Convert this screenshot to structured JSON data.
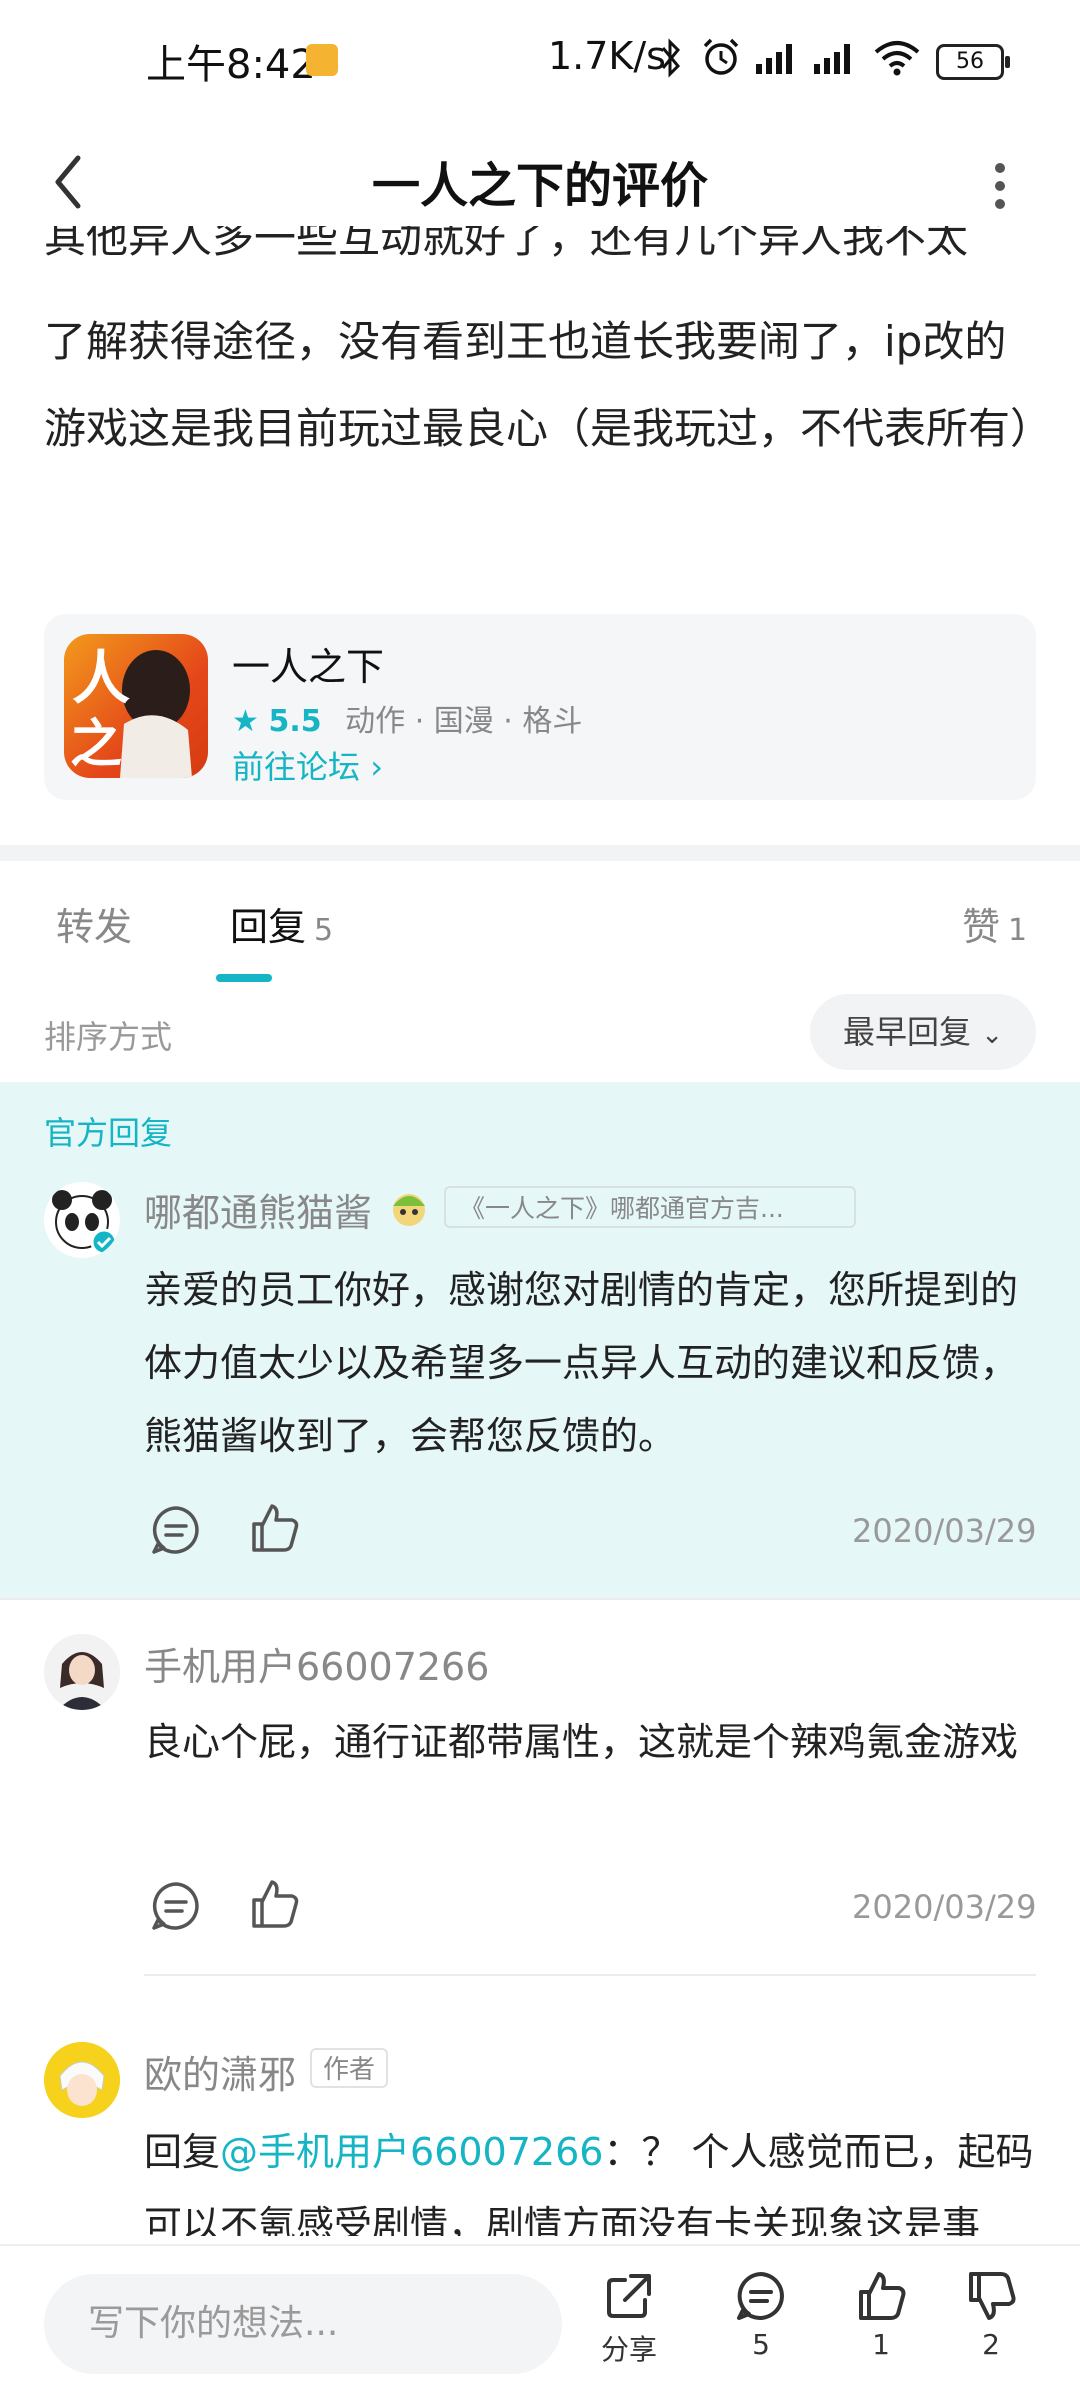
{
  "status_bar": {
    "time": "上午8:42",
    "net_speed": "1.7K/s",
    "battery": "56"
  },
  "header": {
    "title": "一人之下的评价"
  },
  "review": {
    "clipped_line": "其他异人多一些互动就好了，还有几个异人我不太",
    "text": "了解获得途径，没有看到王也道长我要闹了，ip改的游戏这是我目前玩过最良心（是我玩过，不代表所有）"
  },
  "game_card": {
    "name": "一人之下",
    "rating": "5.5",
    "tags": "动作 · 国漫 · 格斗",
    "forum_link": "前往论坛"
  },
  "tabs": {
    "forward": "转发",
    "reply": "回复",
    "reply_count": "5",
    "like": "赞",
    "like_count": "1"
  },
  "sort": {
    "label": "排序方式",
    "value": "最早回复"
  },
  "official": {
    "label": "官方回复",
    "username": "哪都通熊猫酱",
    "tag": "《一人之下》哪都通官方吉...",
    "text": "亲爱的员工你好，感谢您对剧情的肯定，您所提到的体力值太少以及希望多一点异人互动的建议和反馈，熊猫酱收到了，会帮您反馈的。",
    "date": "2020/03/29"
  },
  "comments": [
    {
      "username": "手机用户66007266",
      "text": "良心个屁，通行证都带属性，这就是个辣鸡氪金游戏",
      "date": "2020/03/29"
    },
    {
      "username": "欧的潇邪",
      "badge": "作者",
      "reply_prefix": "回复",
      "mention": "@手机用户66007266",
      "text": "：？ 个人感觉而已，起码可以不氪感受剧情，剧情方面没有卡关现象这是事"
    }
  ],
  "bottom_bar": {
    "input_placeholder": "写下你的想法...",
    "share_label": "分享",
    "comment_count": "5",
    "like_count": "1",
    "dislike_count": "2"
  },
  "colors": {
    "accent": "#15b5c5",
    "official_bg": "#e6f7f8"
  }
}
